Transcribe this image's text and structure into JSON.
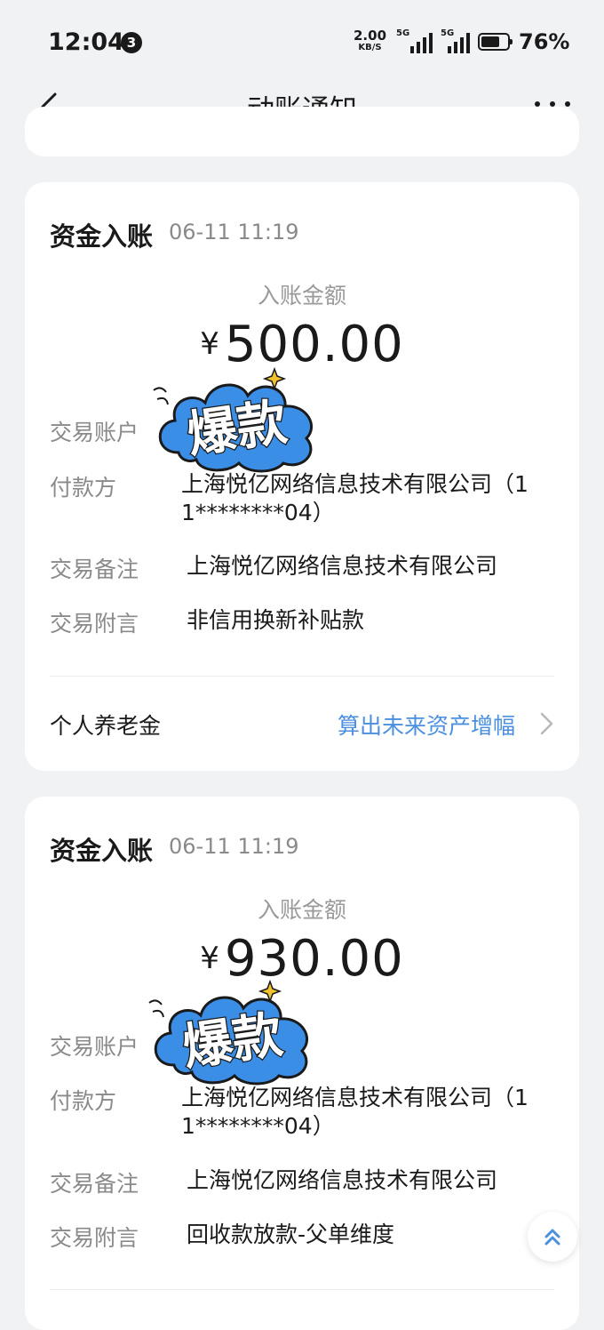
{
  "status_bar": {
    "time": "12:04",
    "notification_count": "3",
    "net_speed": "2.00",
    "net_unit": "KB/S",
    "signal1_tag": "5G",
    "signal2_tag": "5G",
    "battery_percent": "76%",
    "battery_level": 0.76
  },
  "nav": {
    "title": "动账通知"
  },
  "cards": [
    {
      "title": "资金入账",
      "time": "06-11 11:19",
      "amount_label": "入账金额",
      "currency": "¥",
      "amount": "500.00",
      "sticker_text": "爆款",
      "rows": {
        "account_label": "交易账户",
        "payer_label": "付款方",
        "payer_line1": "上海悦亿网络信息技术有限公司（1",
        "payer_line2": "1********04）",
        "memo_label": "交易备注",
        "memo_value": "上海悦亿网络信息技术有限公司",
        "note_label": "交易附言",
        "note_value": "非信用换新补贴款"
      },
      "footer": {
        "left": "个人养老金",
        "link": "算出未来资产增幅"
      }
    },
    {
      "title": "资金入账",
      "time": "06-11 11:19",
      "amount_label": "入账金额",
      "currency": "¥",
      "amount": "930.00",
      "sticker_text": "爆款",
      "rows": {
        "account_label": "交易账户",
        "payer_label": "付款方",
        "payer_line1": "上海悦亿网络信息技术有限公司（1",
        "payer_line2": "1********04）",
        "memo_label": "交易备注",
        "memo_value": "上海悦亿网络信息技术有限公司",
        "note_label": "交易附言",
        "note_value": "回收款放款-父单维度"
      }
    }
  ],
  "colors": {
    "background": "#f1f2f4",
    "link": "#4a8fe0",
    "sticker_blue": "#3a8ee6"
  }
}
